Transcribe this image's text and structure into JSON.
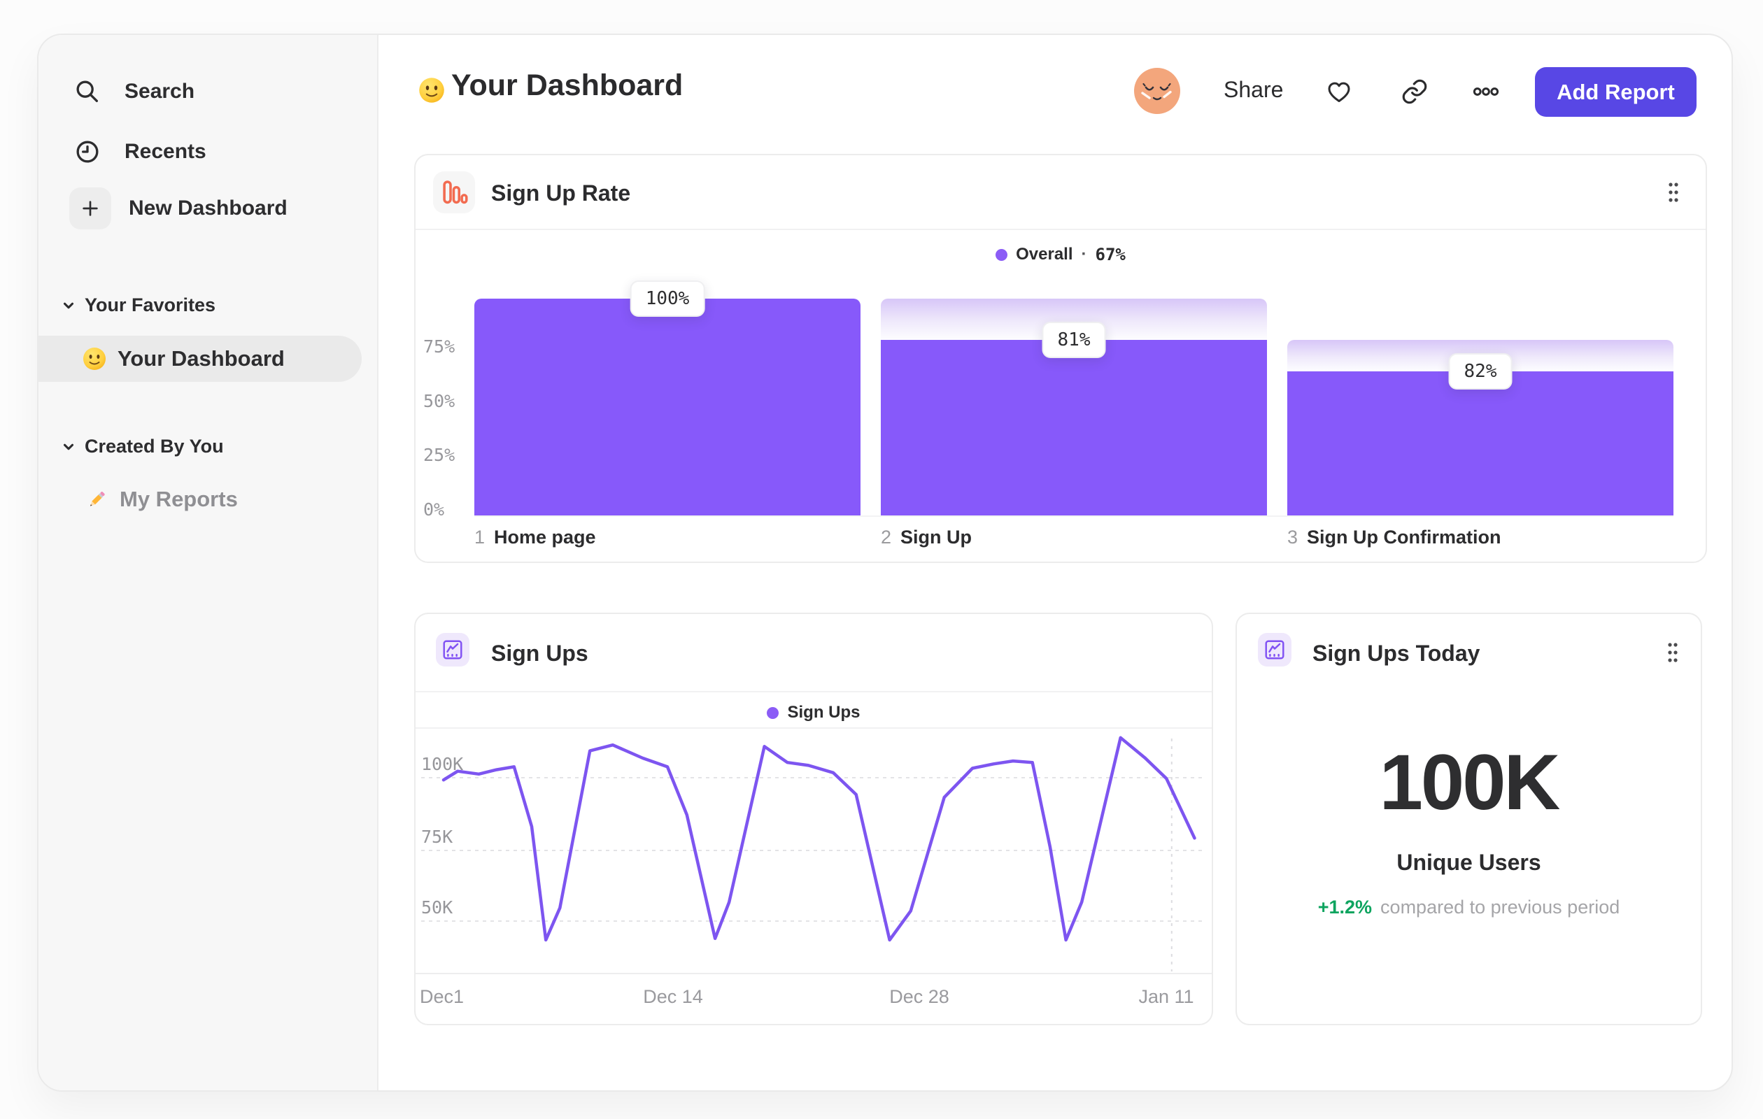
{
  "header": {
    "title": "Your Dashboard",
    "share": "Share",
    "add_report": "Add Report"
  },
  "sidebar": {
    "nav": [
      {
        "label": "Search"
      },
      {
        "label": "Recents"
      },
      {
        "label": "New Dashboard"
      }
    ],
    "sections": [
      {
        "title": "Your Favorites",
        "items": [
          {
            "label": "Your Dashboard",
            "selected": true
          }
        ]
      },
      {
        "title": "Created By You",
        "items": [
          {
            "label": "My Reports",
            "selected": false
          }
        ]
      }
    ]
  },
  "funnel_card": {
    "title": "Sign Up Rate",
    "legend_label": "Overall",
    "legend_sep": "·",
    "legend_value": "67%",
    "y_ticks": [
      {
        "label": "75%",
        "pct": 75
      },
      {
        "label": "50%",
        "pct": 50
      },
      {
        "label": "25%",
        "pct": 25
      },
      {
        "label": "0%",
        "pct": 0
      }
    ],
    "steps": [
      {
        "index": "1",
        "label": "Home page",
        "badge": "100%",
        "pct_of_total": 100,
        "prev_pct_of_total": 100
      },
      {
        "index": "2",
        "label": "Sign Up",
        "badge": "81%",
        "pct_of_total": 81,
        "prev_pct_of_total": 100
      },
      {
        "index": "3",
        "label": "Sign Up Confirmation",
        "badge": "82%",
        "pct_of_total": 66.4,
        "prev_pct_of_total": 81
      }
    ]
  },
  "line_card": {
    "title": "Sign Ups",
    "legend_label": "Sign Ups",
    "y_ticks": [
      {
        "label": "100K",
        "k": 100
      },
      {
        "label": "75K",
        "k": 75
      },
      {
        "label": "50K",
        "k": 50
      }
    ],
    "x_ticks": [
      {
        "label": "Dec1",
        "day": 0
      },
      {
        "label": "Dec 14",
        "day": 13
      },
      {
        "label": "Dec 28",
        "day": 27
      },
      {
        "label": "Jan 11",
        "day": 41
      }
    ]
  },
  "stat_card": {
    "title": "Sign Ups Today",
    "value": "100K",
    "unit_label": "Unique Users",
    "delta": "+1.2%",
    "delta_note": "compared to previous period"
  },
  "colors": {
    "accent_purple": "#8759fa",
    "legend_purple": "#8b5cf6",
    "line_purple": "#7d55f0",
    "button_purple": "#5847e5",
    "funnel_icon_orange": "#f26b50",
    "delta_green": "#0ea45f",
    "avatar_orange": "#f3a67c"
  },
  "chart_data": [
    {
      "id": "sign-up-rate",
      "type": "bar",
      "subtype": "funnel",
      "title": "Sign Up Rate",
      "legend": [
        {
          "label": "Overall",
          "value": "67%",
          "color": "#8b5cf6"
        }
      ],
      "categories": [
        "Home page",
        "Sign Up",
        "Sign Up Confirmation"
      ],
      "step_conversion_pct": [
        100,
        81,
        82
      ],
      "pct_of_initial": [
        100,
        81,
        66.4
      ],
      "overall_conversion": "67%",
      "ylabel_ticks": [
        "0%",
        "25%",
        "50%",
        "75%"
      ],
      "ylim": [
        0,
        100
      ],
      "grid": false,
      "legend_position": "top-center"
    },
    {
      "id": "sign-ups",
      "type": "line",
      "title": "Sign Ups",
      "legend": [
        {
          "label": "Sign Ups",
          "color": "#8b5cf6"
        }
      ],
      "x_unit": "days since Dec 1",
      "y_unit": "thousands of sign ups",
      "x_tick_labels": [
        "Dec1",
        "Dec 14",
        "Dec 28",
        "Jan 11"
      ],
      "x_tick_days": [
        0,
        13,
        27,
        41
      ],
      "y_tick_labels": [
        "100K",
        "75K",
        "50K"
      ],
      "y_tick_values": [
        100,
        75,
        50
      ],
      "ylim": [
        40,
        115
      ],
      "grid": "dotted-horizontal",
      "today_marker_day": 41.3,
      "points": [
        [
          0,
          99
        ],
        [
          0.8,
          102
        ],
        [
          2,
          101
        ],
        [
          3,
          102.5
        ],
        [
          4,
          103.5
        ],
        [
          5,
          83
        ],
        [
          5.8,
          44
        ],
        [
          6.6,
          55
        ],
        [
          8.3,
          109
        ],
        [
          9.6,
          111
        ],
        [
          11.3,
          106.5
        ],
        [
          12.7,
          103.5
        ],
        [
          13.8,
          87
        ],
        [
          15.4,
          44.5
        ],
        [
          16.2,
          57
        ],
        [
          18.2,
          110.5
        ],
        [
          19.5,
          105
        ],
        [
          20.7,
          104
        ],
        [
          22.1,
          101.5
        ],
        [
          23.4,
          94
        ],
        [
          25.3,
          44
        ],
        [
          26.5,
          54
        ],
        [
          28.4,
          93
        ],
        [
          30,
          103
        ],
        [
          31.2,
          104.5
        ],
        [
          32.3,
          105.5
        ],
        [
          33.4,
          105
        ],
        [
          34.4,
          76
        ],
        [
          35.3,
          44
        ],
        [
          36.2,
          57
        ],
        [
          38.4,
          113.5
        ],
        [
          39.8,
          106.5
        ],
        [
          41,
          99.5
        ],
        [
          42.6,
          79
        ]
      ]
    }
  ]
}
